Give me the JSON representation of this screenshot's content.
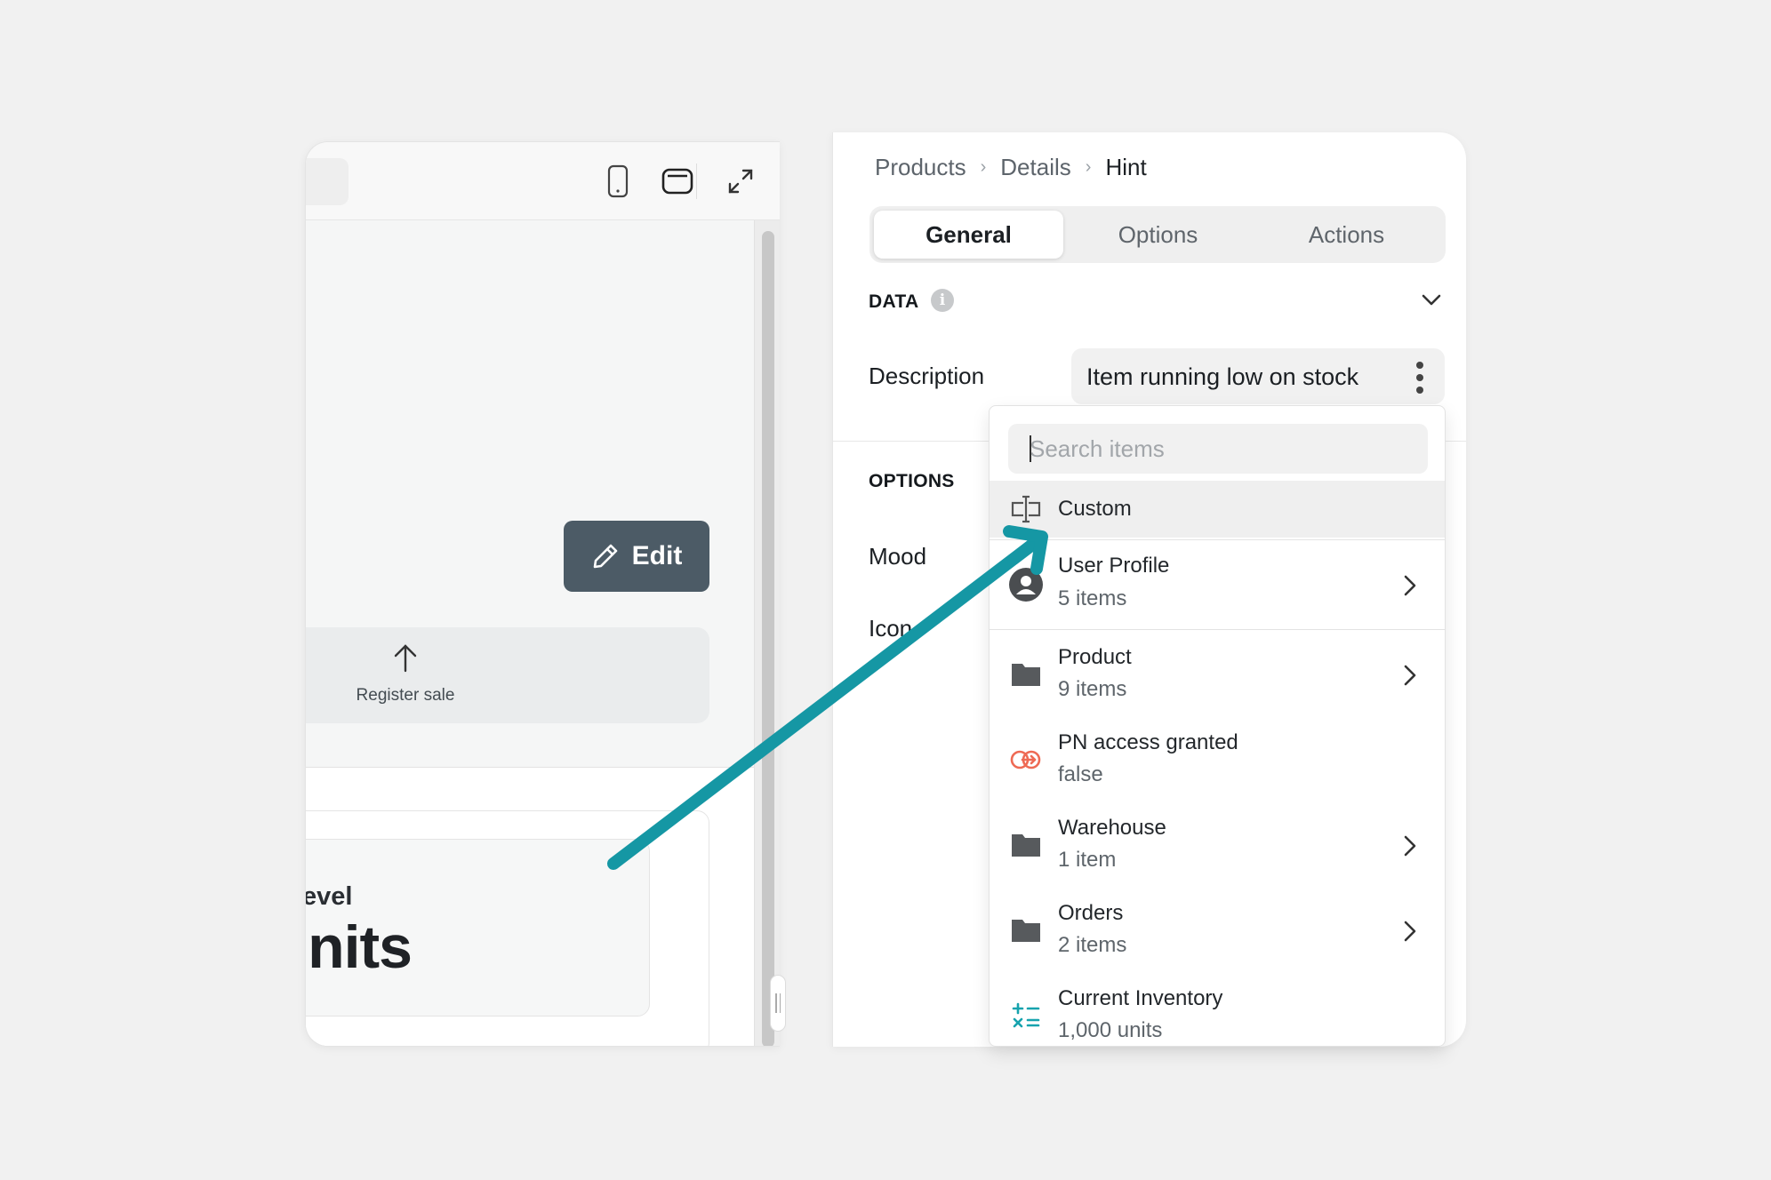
{
  "preview": {
    "edit_label": "Edit",
    "register_label": "Register sale",
    "stock_label": "ck Level",
    "stock_value": ") units"
  },
  "inspector": {
    "breadcrumb": [
      "Products",
      "Details",
      "Hint"
    ],
    "tabs": [
      "General",
      "Options",
      "Actions"
    ],
    "active_tab": "General",
    "data_section": "DATA",
    "info_glyph": "i",
    "description_label": "Description",
    "description_value": "Item running low on stock",
    "options_section": "OPTIONS",
    "mood_label": "Mood",
    "icon_label": "Icon"
  },
  "dropdown": {
    "search_placeholder": "Search items",
    "items": [
      {
        "title": "Custom",
        "icon": "custom-field-icon"
      },
      {
        "title": "User Profile",
        "sub": "5 items",
        "icon": "user-avatar-icon",
        "has_children": true
      },
      {
        "title": "Product",
        "sub": "9 items",
        "icon": "folder-icon",
        "has_children": true
      },
      {
        "title": "PN access granted",
        "sub": "false",
        "icon": "access-link-icon",
        "has_children": false
      },
      {
        "title": "Warehouse",
        "sub": "1 item",
        "icon": "folder-icon",
        "has_children": true
      },
      {
        "title": "Orders",
        "sub": "2 items",
        "icon": "folder-icon",
        "has_children": true
      },
      {
        "title": "Current Inventory",
        "sub": "1,000 units",
        "icon": "calculator-icon",
        "has_children": false
      }
    ]
  },
  "colors": {
    "edit_button": "#4c5b66",
    "annotation_arrow": "#1597a4",
    "access_icon": "#ee6a54",
    "calculator_icon": "#17a3ae"
  }
}
